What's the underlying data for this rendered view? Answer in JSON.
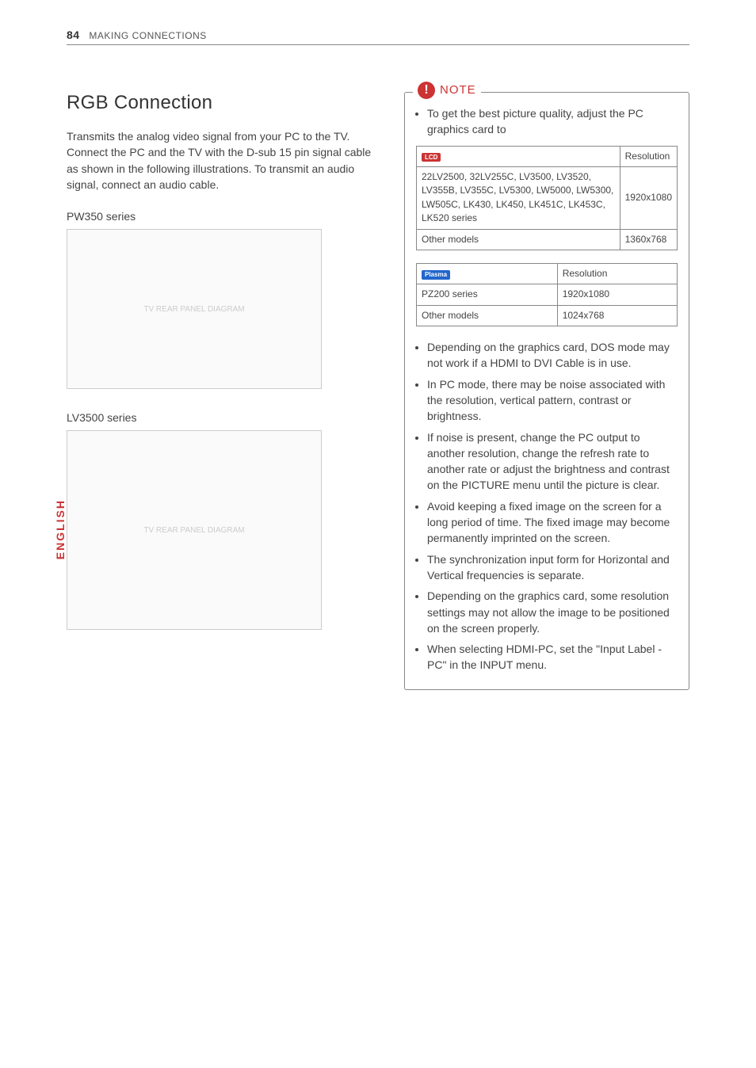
{
  "page": {
    "number": "84",
    "section": "MAKING CONNECTIONS",
    "sidetab": "ENGLISH"
  },
  "rgb": {
    "heading": "RGB Connection",
    "intro": "Transmits the analog video signal from your PC to the TV. Connect the PC and the TV with the D-sub 15 pin signal cable as shown in the following illustrations. To transmit an audio signal, connect an audio cable.",
    "series1": "PW350 series",
    "series2": "LV3500 series"
  },
  "note": {
    "label": "NOTE",
    "intro": "To get the best picture quality, adjust the PC graphics card to",
    "table1": {
      "badge": "LCD",
      "res_header": "Resolution",
      "rows": [
        {
          "models": "22LV2500, 32LV255C, LV3500, LV3520, LV355B, LV355C, LV5300, LW5000, LW5300, LW505C, LK430, LK450, LK451C, LK453C, LK520 series",
          "res": "1920x1080"
        },
        {
          "models": "Other models",
          "res": "1360x768"
        }
      ]
    },
    "table2": {
      "badge": "Plasma",
      "res_header": "Resolution",
      "rows": [
        {
          "models": "PZ200 series",
          "res": "1920x1080"
        },
        {
          "models": "Other models",
          "res": "1024x768"
        }
      ]
    },
    "bullets": [
      "Depending on the graphics card, DOS mode may not work if a HDMI to DVI Cable is in use.",
      "In PC mode, there may be noise associated with the resolution, vertical pattern, contrast or brightness.",
      "If noise is present, change the PC output to another resolution, change the refresh rate to another rate or adjust the brightness and contrast on the PICTURE menu until the picture is clear.",
      "Avoid keeping a fixed image on the screen for a long period of time. The fixed image may become permanently imprinted on the screen.",
      "The synchronization input form for Horizontal and Vertical frequencies is separate.",
      "Depending on the graphics card, some resolution settings may not allow the image to be positioned on the screen properly.",
      "When selecting HDMI-PC, set the \"Input Label - PC\" in the INPUT menu."
    ]
  }
}
